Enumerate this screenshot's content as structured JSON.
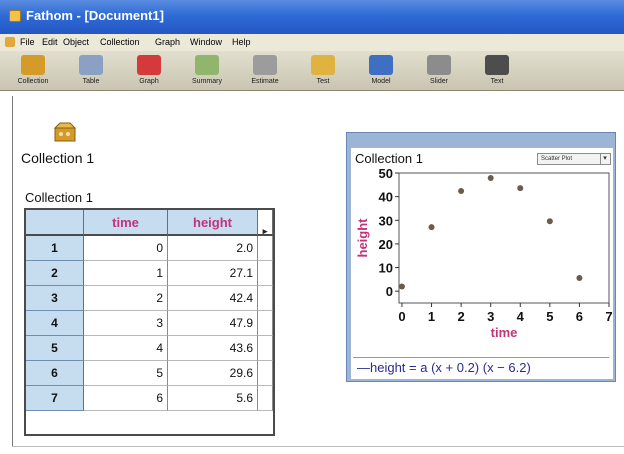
{
  "window": {
    "title": "Fathom - [Document1]"
  },
  "menu": {
    "items": [
      "File",
      "Edit",
      "Object",
      "Collection",
      "Graph",
      "Window",
      "Help"
    ]
  },
  "toolbar": {
    "items": [
      {
        "label": "Collection",
        "icon": "collection-box-icon",
        "color": "#d49a2a"
      },
      {
        "label": "Table",
        "icon": "table-icon",
        "color": "#8aa1c4"
      },
      {
        "label": "Graph",
        "icon": "graph-icon",
        "color": "#d43a3a"
      },
      {
        "label": "Summary",
        "icon": "summary-icon",
        "color": "#92b56d"
      },
      {
        "label": "Estimate",
        "icon": "estimate-icon",
        "color": "#9c9c9c"
      },
      {
        "label": "Test",
        "icon": "test-icon",
        "color": "#e0b23f"
      },
      {
        "label": "Model",
        "icon": "model-icon",
        "color": "#3f6fc2"
      },
      {
        "label": "Slider",
        "icon": "slider-icon",
        "color": "#8c8c8c"
      },
      {
        "label": "Text",
        "icon": "text-icon",
        "color": "#4d4d4d"
      }
    ]
  },
  "collection": {
    "name": "Collection 1",
    "icon": "collection-box-icon"
  },
  "table": {
    "title": "Collection 1",
    "columns": [
      "time",
      "height"
    ],
    "rows": [
      {
        "index": "1",
        "time": "0",
        "height": "2.0"
      },
      {
        "index": "2",
        "time": "1",
        "height": "27.1"
      },
      {
        "index": "3",
        "time": "2",
        "height": "42.4"
      },
      {
        "index": "4",
        "time": "3",
        "height": "47.9"
      },
      {
        "index": "5",
        "time": "4",
        "height": "43.6"
      },
      {
        "index": "6",
        "time": "5",
        "height": "29.6"
      },
      {
        "index": "7",
        "time": "6",
        "height": "5.6"
      }
    ]
  },
  "graph": {
    "title": "Collection 1",
    "dropdown": "Scatter Plot",
    "formula": "height = a (x + 0.2) (x − 6.2)"
  },
  "chart_data": {
    "type": "scatter",
    "xlabel": "time",
    "ylabel": "height",
    "xticks": [
      "0",
      "1",
      "2",
      "3",
      "4",
      "5",
      "6",
      "7"
    ],
    "yticks": [
      "0",
      "10",
      "20",
      "30",
      "40",
      "50"
    ],
    "xlim": [
      -0.1,
      7
    ],
    "ylim": [
      -5,
      50
    ],
    "points": [
      {
        "x": 0,
        "y": 2.0
      },
      {
        "x": 1,
        "y": 27.1
      },
      {
        "x": 2,
        "y": 42.4
      },
      {
        "x": 3,
        "y": 47.9
      },
      {
        "x": 4,
        "y": 43.6
      },
      {
        "x": 5,
        "y": 29.6
      },
      {
        "x": 6,
        "y": 5.6
      }
    ],
    "colors": {
      "point": "#6b5b4b",
      "axis_label": "#c2337a",
      "frame": "#9cb4d6"
    }
  }
}
